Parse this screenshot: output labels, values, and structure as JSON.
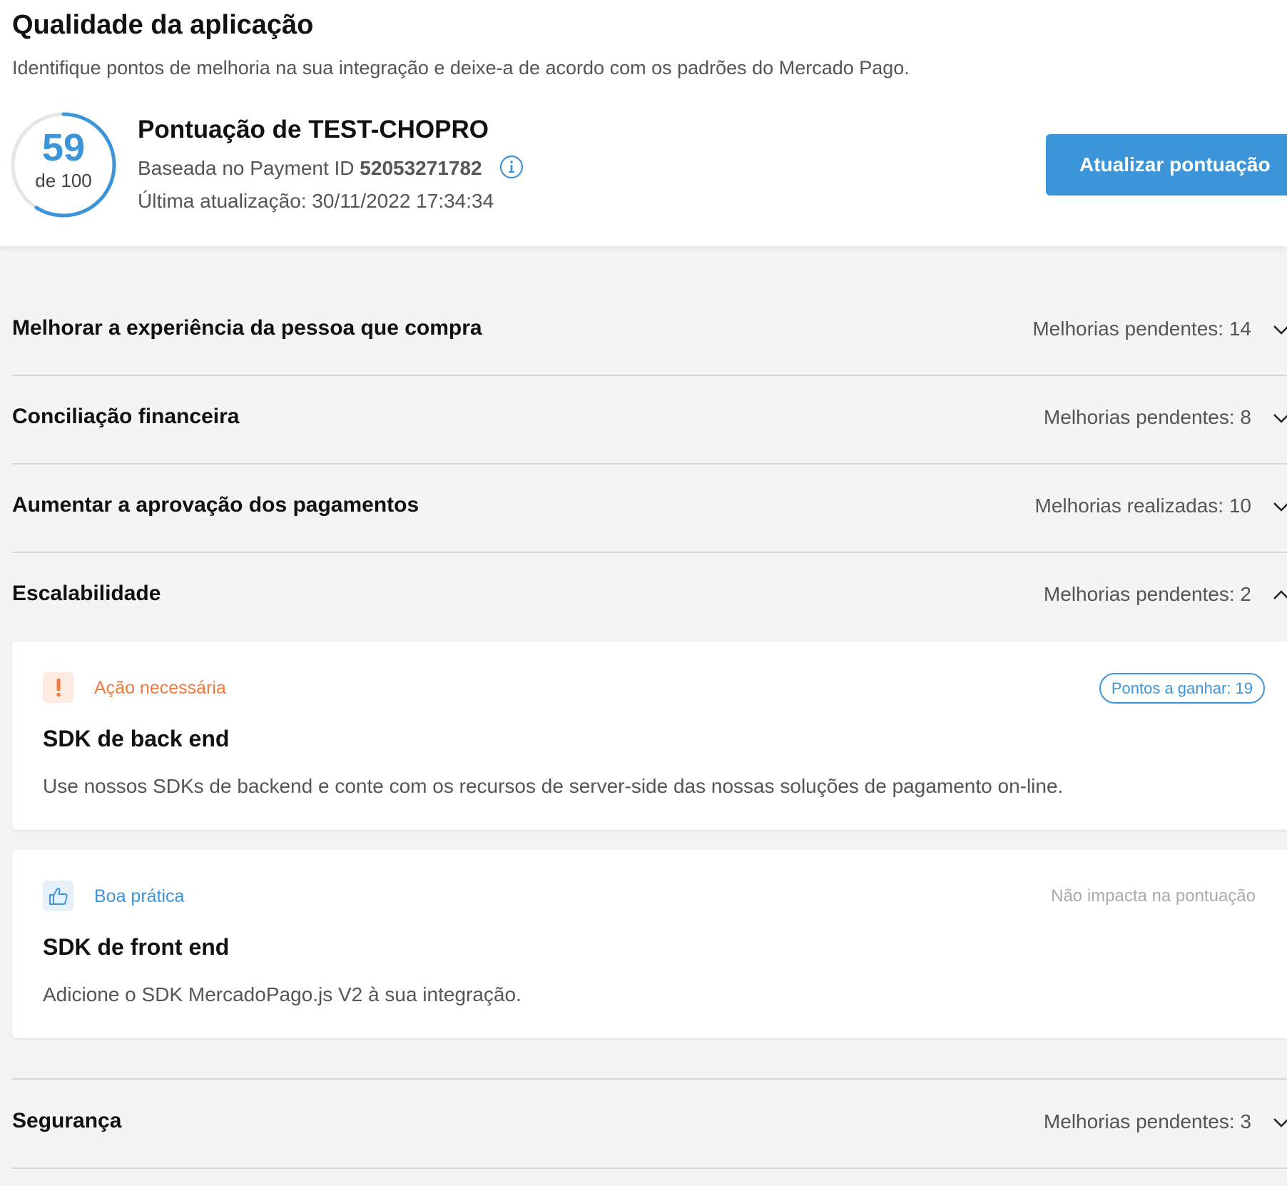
{
  "header": {
    "title": "Qualidade da aplicação",
    "subtitle": "Identifique pontos de melhoria na sua integração e deixe-a de acordo com os padrões do Mercado Pago.",
    "score": {
      "value": "59",
      "total_label": "de 100",
      "progress_fraction": 0.59,
      "title": "Pontuação de TEST-CHOPRO",
      "payment_prefix": "Baseada no Payment ID ",
      "payment_id": "52053271782",
      "updated": "Última atualização: 30/11/2022 17:34:34",
      "info_icon": "info-icon"
    },
    "refresh_button": "Atualizar pontuação"
  },
  "sections": [
    {
      "title": "Melhorar a experiência da pessoa que compra",
      "status": "Melhorias pendentes: 14",
      "expanded": false
    },
    {
      "title": "Conciliação financeira",
      "status": "Melhorias pendentes: 8",
      "expanded": false
    },
    {
      "title": "Aumentar a aprovação dos pagamentos",
      "status": "Melhorias realizadas: 10",
      "expanded": false
    },
    {
      "title": "Escalabilidade",
      "status": "Melhorias pendentes: 2",
      "expanded": true
    },
    {
      "title": "Segurança",
      "status": "Melhorias pendentes: 3",
      "expanded": false
    }
  ],
  "cards": [
    {
      "icon": "exclamation-icon",
      "status": "Ação necessária",
      "points": "Pontos a ganhar: 19",
      "title": "SDK de back end",
      "description": "Use nossos SDKs de backend e conte com os recursos de server-side das nossas soluções de pagamento on-line."
    },
    {
      "icon": "thumbs-up-icon",
      "status": "Boa prática",
      "points_note": "Não impacta na pontuação",
      "title": "SDK de front end",
      "description": "Adicione o SDK MercadoPago.js V2 à sua integração."
    }
  ],
  "colors": {
    "accent": "#3d95d9",
    "warning": "#f07a3d",
    "background": "#f4f4f4"
  }
}
